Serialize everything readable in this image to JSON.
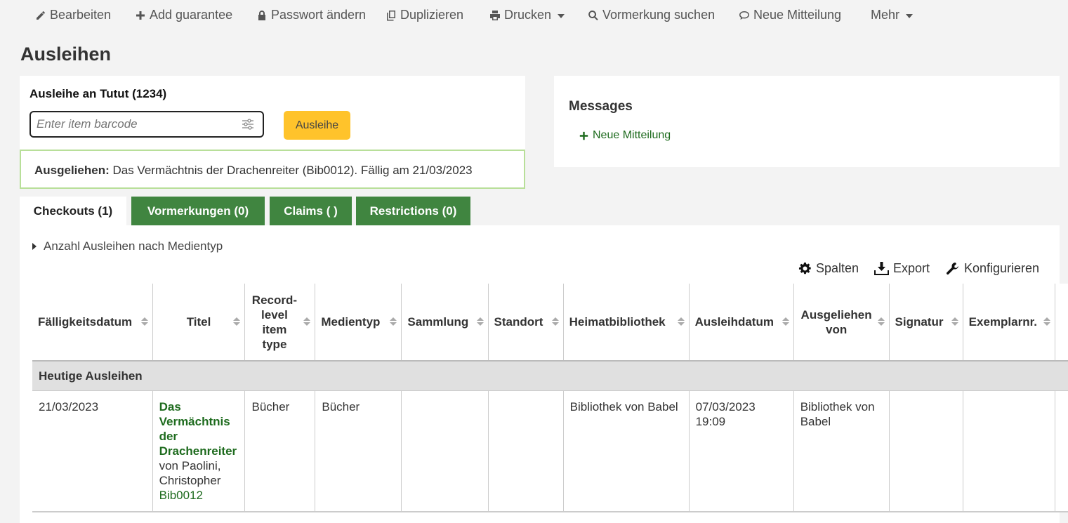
{
  "toolbar": {
    "items": [
      {
        "label": "Bearbeiten",
        "icon": "pencil-icon"
      },
      {
        "label": "Add guarantee",
        "icon": "plus-icon"
      },
      {
        "label": "Passwort ändern",
        "icon": "lock-icon"
      },
      {
        "label": "Duplizieren",
        "icon": "copy-icon"
      },
      {
        "label": "Drucken",
        "icon": "print-icon"
      },
      {
        "label": "Vormerkung suchen",
        "icon": "search-icon"
      },
      {
        "label": "Neue Mitteilung",
        "icon": "comment-icon"
      },
      {
        "label": "Mehr",
        "icon": "chevron-down-icon"
      }
    ]
  },
  "page": {
    "title": "Ausleihen"
  },
  "checkout": {
    "label": "Ausleihe an Tutut (1234)",
    "placeholder": "Enter item barcode",
    "button": "Ausleihe"
  },
  "alert": {
    "label": "Ausgeliehen:",
    "text": " Das Vermächtnis der Drachenreiter (Bib0012). Fällig am 21/03/2023"
  },
  "messages": {
    "header": "Messages",
    "new_label": "Neue Mitteilung"
  },
  "tabs": [
    {
      "label": "Checkouts (1)",
      "active": true
    },
    {
      "label": "Vormerkungen (0)",
      "active": false
    },
    {
      "label": "Claims ( )",
      "active": false
    },
    {
      "label": "Restrictions (0)",
      "active": false
    }
  ],
  "collapse_label": "Anzahl Ausleihen nach Medientyp",
  "table_tools": {
    "columns": "Spalten",
    "export": "Export",
    "configure": "Konfigurieren"
  },
  "table": {
    "headers": [
      "Fälligkeitsdatum",
      "Titel",
      "Record-level item type",
      "Medientyp",
      "Sammlung",
      "Standort",
      "Heimatbibliothek",
      "Ausleihdatum",
      "Ausgeliehen von",
      "Signatur",
      "Exemplarnr."
    ],
    "group_label": "Heutige Ausleihen",
    "rows": [
      {
        "due": "21/03/2023",
        "title": "Das Vermächtnis der Drachenreiter",
        "author": "von Paolini, Christopher",
        "barcode": "Bib0012",
        "record_type": "Bücher",
        "itemtype": "Bücher",
        "collection": "",
        "location": "",
        "homebranch": "Bibliothek von Babel",
        "issuedate": "07/03/2023 19:09",
        "checked_out_from": "Bibliothek von Babel",
        "callnumber": "",
        "copynumber": ""
      }
    ]
  },
  "colors": {
    "accent_green": "#408540",
    "link_green": "#1e6b1e",
    "button_yellow": "#ffc32b",
    "alert_border": "#b8df99"
  }
}
